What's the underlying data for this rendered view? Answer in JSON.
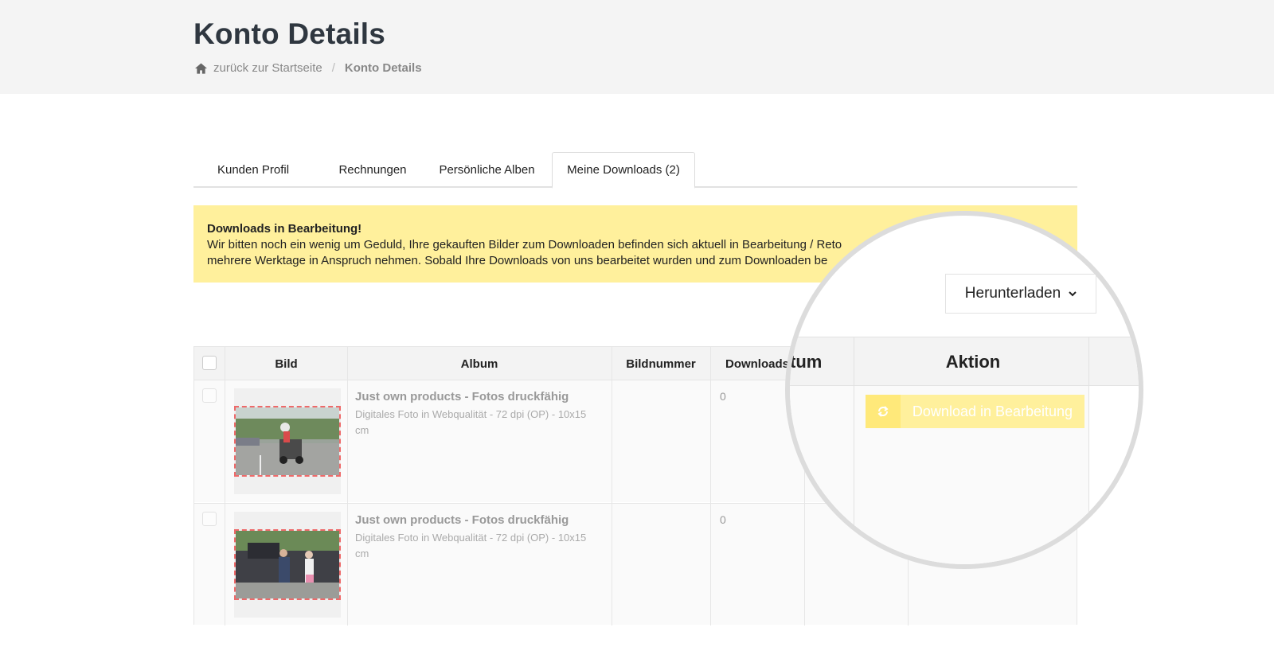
{
  "header": {
    "title": "Konto Details",
    "breadcrumb": {
      "home_label": "zurück zur Startseite",
      "separator": "/",
      "current": "Konto Details"
    }
  },
  "tabs": [
    {
      "label": "Kunden Profil"
    },
    {
      "label": "Rechnungen"
    },
    {
      "label": "Persönliche Alben"
    },
    {
      "label": "Meine Downloads (2)",
      "active": true
    }
  ],
  "alert": {
    "title": "Downloads in Bearbeitung!",
    "line1": "Wir bitten noch ein wenig um Geduld, Ihre gekauften Bilder zum Downloaden befinden sich aktuell in Bearbeitung / Reto",
    "line2": "mehrere Werktage in Anspruch nehmen. Sobald Ihre Downloads von uns bearbeitet wurden und zum Downloaden be"
  },
  "table": {
    "columns": [
      "Bild",
      "Album",
      "Bildnummer",
      "Downloads"
    ],
    "rows": [
      {
        "album_title": "Just own products - Fotos druckfähig",
        "album_sub": "Digitales Foto in Webqualität - 72 dpi (OP) - 10x15 cm",
        "bildnummer": "",
        "downloads": "0"
      },
      {
        "album_title": "Just own products - Fotos druckfähig",
        "album_sub": "Digitales Foto in Webqualität - 72 dpi (OP) - 10x15 cm",
        "bildnummer": "",
        "downloads": "0"
      }
    ]
  },
  "magnifier": {
    "dropdown_label": "Herunterladen",
    "col_datum": "tum",
    "col_aktion": "Aktion",
    "button_label": "Download in Bearbeitung"
  },
  "colors": {
    "alert_bg": "#fff09c",
    "header_bg": "#f4f4f4",
    "title": "#2f3740"
  }
}
